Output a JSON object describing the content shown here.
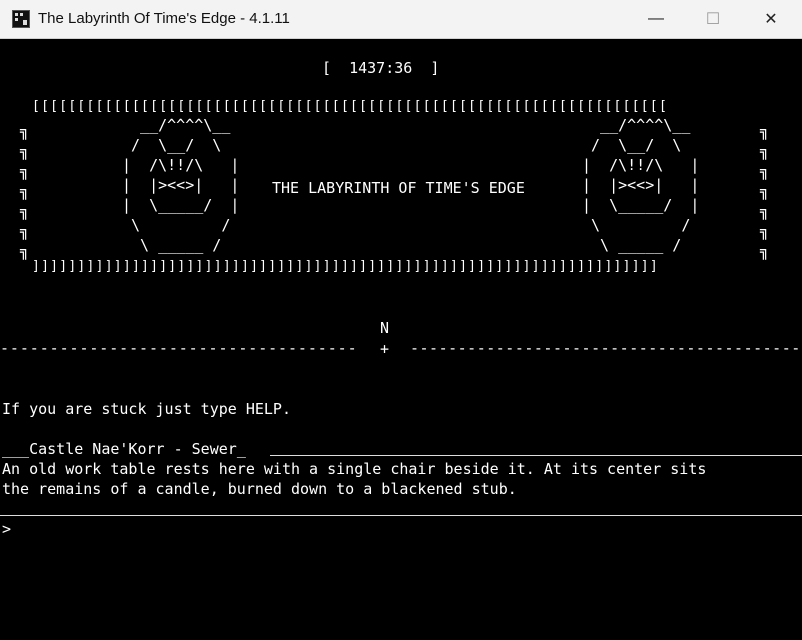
{
  "window": {
    "title": "The Labyrinth Of Time's Edge - 4.1.11",
    "minimize": "—",
    "maximize": "☐",
    "close": "✕"
  },
  "timer": {
    "text": "[  1437:36  ]"
  },
  "banner": {
    "top_border": "[[[[[[[[[[[[[[[[[[[[[[[[[[[[[[[[[[[[[[[[[[[[[[[[[[[[[[[[[[[[[[[[[[[[[[",
    "bottom_border": "]]]]]]]]]]]]]]]]]]]]]]]]]]]]]]]]]]]]]]]]]]]]]]]]]]]]]]]]]]]]]]]]]]]]]",
    "left_edge": [
      "╗",
      "╗",
      "╗",
      "╗",
      "╗",
      "╗",
      "╗"
    ],
    "right_edge": [
      "╗",
      "╗",
      "╗",
      "╗",
      "╗",
      "╗",
      "╗"
    ],
    "title": "THE LABYRINTH OF TIME'S EDGE",
    "art_left": [
      "  __/^^^^\\__",
      " /  \\__/  \\",
      "|  /\\!!/\\   |",
      "|  |><<>|   |",
      "|  \\_____/  |",
      " \\         /",
      "  \\ _____ /"
    ],
    "art_right": [
      "  __/^^^^\\__",
      " /  \\__/  \\",
      "|  /\\!!/\\   |",
      "|  |><<>|   |",
      "|  \\_____/  |",
      " \\         /",
      "  \\ _____ /"
    ]
  },
  "compass": {
    "north": "N",
    "left_dashes": "------------------------------------",
    "center": "+",
    "right_dashes": "------------------------------------------"
  },
  "help_text": "If you are stuck just type HELP.",
  "room": {
    "prefix": "___",
    "name": "Castle Nae'Korr - Sewer",
    "suffix": "_",
    "description": [
      "An old work table rests here with a single chair beside it. At its center sits",
      "the remains of a candle, burned down to a blackened stub."
    ]
  },
  "prompt": {
    "symbol": ">",
    "value": ""
  }
}
